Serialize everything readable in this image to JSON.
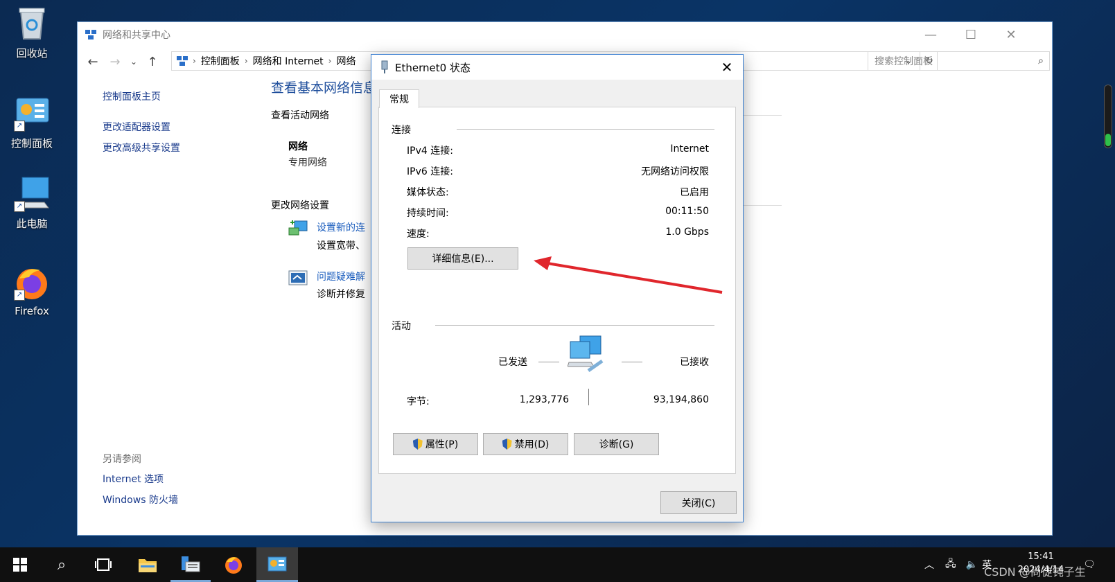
{
  "desktop": {
    "icons": [
      {
        "label": "回收站",
        "icon": "recycle-bin-icon"
      },
      {
        "label": "控制面板",
        "icon": "control-panel-icon"
      },
      {
        "label": "此电脑",
        "icon": "this-pc-icon"
      },
      {
        "label": "Firefox",
        "icon": "firefox-icon"
      }
    ]
  },
  "window": {
    "title": "网络和共享中心",
    "breadcrumb": [
      "控制面板",
      "网络和 Internet",
      "网络"
    ],
    "search_placeholder": "搜索控制面板",
    "sidebar": {
      "links": [
        "控制面板主页",
        "更改适配器设置",
        "更改高级共享设置"
      ],
      "see_also_title": "另请参阅",
      "see_also_links": [
        "Internet 选项",
        "Windows 防火墙"
      ]
    },
    "main": {
      "heading": "查看基本网络信息",
      "active_networks_label": "查看活动网络",
      "network_name": "网络",
      "network_type": "专用网络",
      "change_settings_label": "更改网络设置",
      "task1_title": "设置新的连",
      "task1_desc": "设置宽带、",
      "task2_title": "问题疑难解",
      "task2_desc": "诊断并修复"
    }
  },
  "dialog": {
    "title": "Ethernet0 状态",
    "tab": "常规",
    "connection_group": "连接",
    "rows": [
      {
        "label": "IPv4 连接:",
        "value": "Internet"
      },
      {
        "label": "IPv6 连接:",
        "value": "无网络访问权限"
      },
      {
        "label": "媒体状态:",
        "value": "已启用"
      },
      {
        "label": "持续时间:",
        "value": "00:11:50"
      },
      {
        "label": "速度:",
        "value": "1.0 Gbps"
      }
    ],
    "details_button": "详细信息(E)...",
    "activity_group": "活动",
    "sent_label": "已发送",
    "received_label": "已接收",
    "bytes_label": "字节:",
    "bytes_sent": "1,293,776",
    "bytes_received": "93,194,860",
    "properties_button": "属性(P)",
    "disable_button": "禁用(D)",
    "diagnose_button": "诊断(G)",
    "close_button": "关闭(C)"
  },
  "taskbar": {
    "ime": "英",
    "time": "15:41",
    "date": "2024/4/14",
    "watermark": "CSDN @尚徒钝子生"
  },
  "colors": {
    "accent": "#3b7fd0",
    "link": "#1a5dbe",
    "arrow": "#e0262c"
  }
}
